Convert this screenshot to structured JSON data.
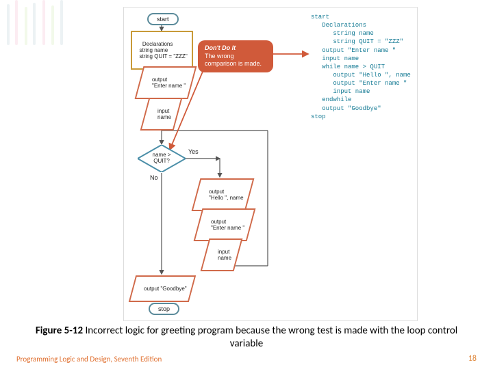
{
  "flowchart": {
    "start": "start",
    "declarations": "Declarations\n  string name\n  string QUIT = \"ZZZ\"",
    "output_enter1": "output\n\"Enter name \"",
    "input_name1": "input\nname",
    "decision": "name >\nQUIT?",
    "decision_yes": "Yes",
    "decision_no": "No",
    "output_hello": "output\n\"Hello \", name",
    "output_enter2": "output\n\"Enter name \"",
    "input_name2": "input\nname",
    "output_goodbye": "output \"Goodbye\"",
    "stop": "stop"
  },
  "callout": {
    "title": "Don't Do It",
    "body": "The wrong comparison is made."
  },
  "pseudocode": "start\n   Declarations\n      string name\n      string QUIT = \"ZZZ\"\n   output \"Enter name \"\n   input name\n   while name > QUIT\n      output \"Hello \", name\n      output \"Enter name \"\n      input name\n   endwhile\n   output \"Goodbye\"\nstop",
  "caption_label": "Figure 5-12",
  "caption_text": " Incorrect logic for greeting program because the wrong test is made with the loop control variable",
  "footer_book": "Programming Logic and Design, Seventh Edition",
  "footer_page": "18"
}
